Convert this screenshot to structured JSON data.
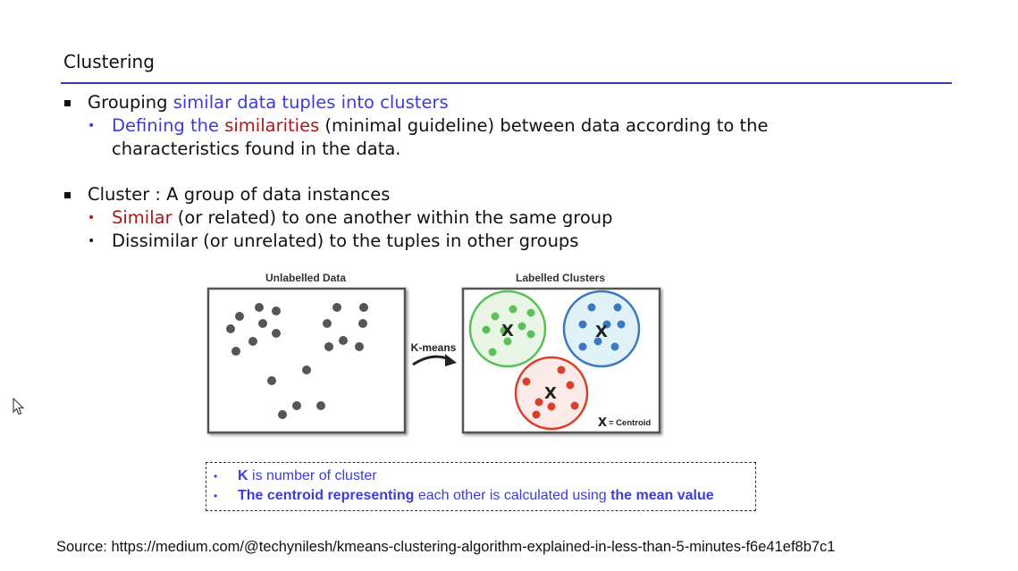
{
  "slide": {
    "title": "Clustering"
  },
  "bullets": {
    "b1": {
      "part1": "Grouping ",
      "part2": "similar data tuples into clusters"
    },
    "b1_sub": {
      "part1": "Defining the ",
      "part2": "similarities",
      "part3": " (minimal guideline) between data according to the",
      "line2": "characteristics found in the data."
    },
    "b2": {
      "text": "Cluster : A group of data instances"
    },
    "b2_sub1": {
      "part1": "Similar",
      "part2": " (or related) to one another within the same group"
    },
    "b2_sub2": {
      "text": "Dissimilar (or unrelated) to the tuples in other groups"
    }
  },
  "figure": {
    "left_title": "Unlabelled Data",
    "right_title": "Labelled Clusters",
    "arrow_label": "K-means",
    "centroid_marker": "X",
    "centroid_legend": "= Centroid",
    "colors": {
      "green": "#5cc05a",
      "blue": "#3a78c2",
      "red": "#d9402c",
      "points": "#555555"
    }
  },
  "note": {
    "line1_bold": "K",
    "line1_rest": " is number of cluster",
    "line2_bold1": "The centroid representing",
    "line2_mid": " each other is calculated using ",
    "line2_bold2": "the mean value"
  },
  "source": {
    "text": "Source: https://medium.com/@techynilesh/kmeans-clustering-algorithm-explained-in-less-than-5-minutes-f6e41ef8b7c1"
  },
  "colors": {
    "accent_blue": "#3b3be0",
    "accent_red": "#b01515",
    "rule": "#3a3aa6"
  },
  "icons": {
    "cursor": "mouse-pointer-icon"
  }
}
